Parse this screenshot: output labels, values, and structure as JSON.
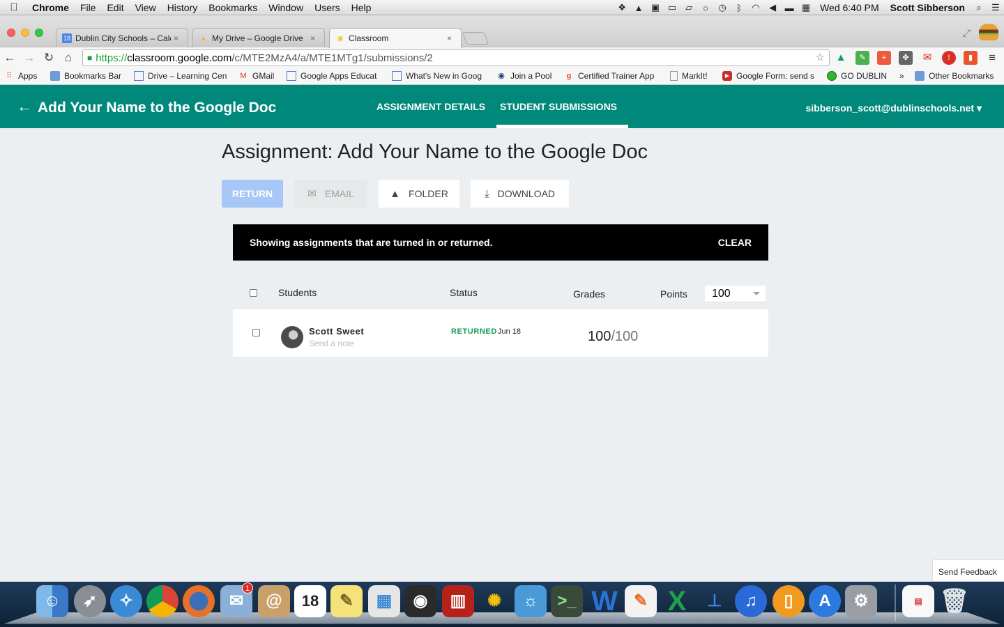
{
  "menubar": {
    "app": "Chrome",
    "items": [
      "File",
      "Edit",
      "View",
      "History",
      "Bookmarks",
      "Window",
      "Users",
      "Help"
    ],
    "clock": "Wed 6:40 PM",
    "user": "Scott Sibberson"
  },
  "browser": {
    "tabs": [
      {
        "title": "Dublin City Schools – Cale",
        "favicon": "calendar-icon",
        "favicon_text": "18",
        "favicon_color": "#4a86e8"
      },
      {
        "title": "My Drive – Google Drive",
        "favicon": "drive-icon",
        "favicon_text": "▲",
        "favicon_color": "#f4b400"
      },
      {
        "title": "Classroom",
        "favicon": "classroom-icon",
        "favicon_text": "▣",
        "favicon_color": "#f4c20d"
      }
    ],
    "close_glyph": "×",
    "url_scheme": "https://",
    "url_host": "classroom.google.com",
    "url_path": "/c/MTE2MzA4/a/MTE1MTg1/submissions/2",
    "bookmarks": [
      {
        "label": "Apps",
        "icon": "apps-icon"
      },
      {
        "label": "Bookmarks Bar",
        "icon": "folder-icon"
      },
      {
        "label": "Drive – Learning Cen",
        "icon": "doc-icon"
      },
      {
        "label": "GMail",
        "icon": "gmail-icon"
      },
      {
        "label": "Google Apps Educat",
        "icon": "doc-icon"
      },
      {
        "label": "What's New in Goog",
        "icon": "doc-icon"
      },
      {
        "label": "Join a Pool",
        "icon": "pool-icon"
      },
      {
        "label": "Certified Trainer App",
        "icon": "google-icon"
      },
      {
        "label": "MarkIt!",
        "icon": "page-icon"
      },
      {
        "label": "Google Form: send s",
        "icon": "youtube-icon"
      },
      {
        "label": "GO DUBLIN",
        "icon": "green-circle-icon"
      },
      {
        "label": "»",
        "icon": ""
      },
      {
        "label": "Other Bookmarks",
        "icon": "folder-icon"
      }
    ]
  },
  "header": {
    "title": "Add Your Name to the Google Doc",
    "tabs": [
      "ASSIGNMENT DETAILS",
      "STUDENT SUBMISSIONS"
    ],
    "active_tab": "STUDENT SUBMISSIONS",
    "account": "sibberson_scott@dublinschools.net",
    "color": "#00897b"
  },
  "main": {
    "title": "Assignment: Add Your Name to the Google Doc",
    "actions": {
      "return": "RETURN",
      "email": "EMAIL",
      "folder": "FOLDER",
      "download": "DOWNLOAD"
    },
    "filter": {
      "text": "Showing assignments that are turned in or returned.",
      "clear": "CLEAR"
    },
    "columns": {
      "students": "Students",
      "status": "Status",
      "grades": "Grades",
      "points": "Points"
    },
    "points_value": "100",
    "rows": [
      {
        "name": "Scott Sweet",
        "note": "Send a note",
        "status": "RETURNED",
        "date": "Jun 18",
        "grade": "100",
        "max": "/100"
      }
    ]
  },
  "feedback": "Send Feedback",
  "dock": {
    "badge": "1",
    "calendar_day": "18"
  }
}
